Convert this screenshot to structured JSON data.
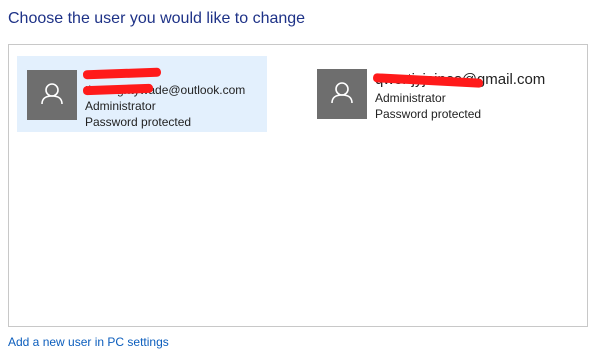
{
  "heading": "Choose the user you would like to change",
  "users": [
    {
      "name": "",
      "email": "thrnwightywade@outlook.com",
      "role": "Administrator",
      "status": "Password protected",
      "selected": true
    },
    {
      "name": "",
      "email": "qwertjyjaines@gmail.com",
      "role": "Administrator",
      "status": "Password protected",
      "selected": false
    }
  ],
  "add_user_link": "Add a new user in PC settings",
  "colors": {
    "heading": "#1e3287",
    "selected_tile": "#e3f0fd",
    "avatar": "#6e6e6e",
    "redaction": "#ff1a1a",
    "link": "#0c5ebd"
  },
  "icons": {
    "avatar": "person-icon"
  }
}
